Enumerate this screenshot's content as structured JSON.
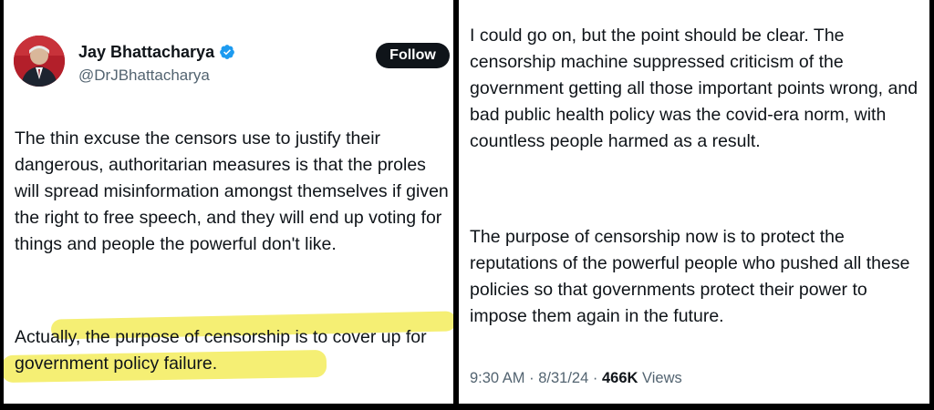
{
  "post": {
    "author": {
      "name": "Jay Bhattacharya",
      "handle": "@DrJBhattacharya",
      "verified_icon": "verified-badge-icon"
    },
    "follow_label": "Follow",
    "paragraph_1": "The thin excuse the censors use to justify their dangerous, authoritarian measures is that the proles will spread misinformation amongst themselves if given the right to free speech, and they will end up voting for things and people the powerful don't like.",
    "paragraph_2": "Actually, the purpose of censorship is to cover up for government policy failure.",
    "paragraph_3": "I could go on, but the point should be clear. The censorship machine suppressed criticism of the government getting all those important points wrong, and bad public health policy was the covid-era norm, with countless people harmed as a result.",
    "paragraph_4": "The purpose of censorship now is to protect the reputations of the powerful people who pushed all these policies so that governments protect their power to impose them again in the future.",
    "time": "9:30 AM",
    "separator": "·",
    "date": "8/31/24",
    "views_count": "466K",
    "views_label": "Views"
  },
  "colors": {
    "text": "#0f1419",
    "secondary_text": "#536471",
    "verified_blue": "#1d9bf0",
    "highlight_yellow": "#f3ec5c",
    "border": "#000000"
  }
}
